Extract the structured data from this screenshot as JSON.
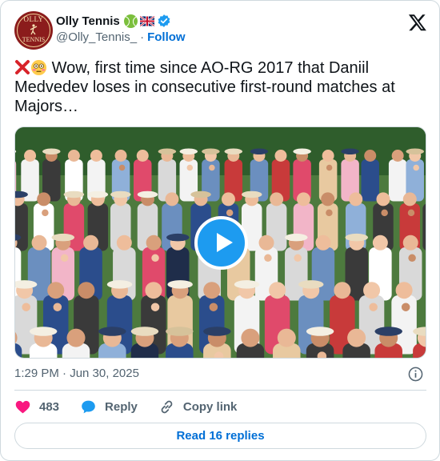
{
  "author": {
    "name": "Olly Tennis",
    "handle": "@Olly_Tennis_",
    "follow_label": "Follow",
    "separator": "·",
    "avatar_text_top": "OLLY",
    "avatar_text_bottom": "TENNIS"
  },
  "tweet": {
    "text": "Wow, first time since AO-RG 2017 that Daniil Medvedev loses in consecutive first-round matches at Majors…",
    "timestamp": "1:29 PM · Jun 30, 2025"
  },
  "actions": {
    "likes_count": "483",
    "reply_label": "Reply",
    "copy_link_label": "Copy link"
  },
  "replies_button": "Read 16 replies",
  "colors": {
    "accent": "#1d9bf0",
    "link": "#006fd6",
    "like": "#f91880",
    "muted": "#536471",
    "border": "#cfd9de"
  },
  "icons": [
    "tennis-ball-icon",
    "uk-flag-icon",
    "verified-badge-icon",
    "x-logo-icon",
    "cross-mark-icon",
    "flushed-face-icon",
    "play-icon",
    "info-icon",
    "heart-icon",
    "reply-bubble-icon",
    "link-icon"
  ]
}
